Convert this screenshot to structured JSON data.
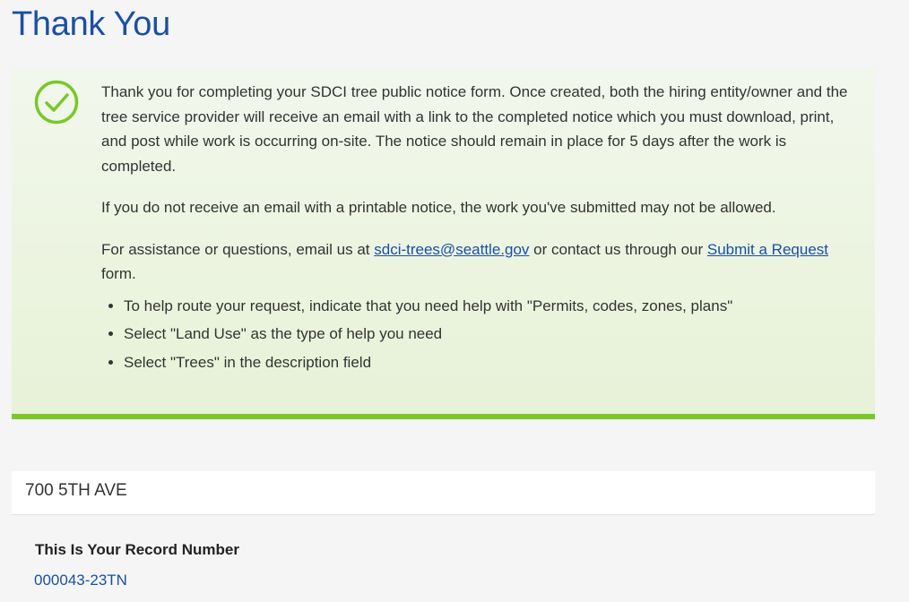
{
  "page": {
    "title": "Thank You"
  },
  "notice": {
    "icon": "check-circle-icon",
    "accent_color": "#7ac72a",
    "paragraph1": "Thank you for completing your SDCI tree public notice form. Once created, both the hiring entity/owner and the tree service provider will receive an email with a link to the completed notice which you must download, print, and post while work is occurring on-site. The notice should remain in place for 5 days after the work is completed.",
    "paragraph2": "If you do not receive an email with a printable notice, the work you've submitted may not be allowed.",
    "assistance": {
      "text_before": "For assistance or questions, email us at ",
      "email_link": "sdci-trees@seattle.gov",
      "text_middle": " or contact us through our ",
      "request_link": "Submit a Request",
      "text_after": " form."
    },
    "bullets": [
      "To help route your request, indicate that you need help with \"Permits, codes, zones, plans\"",
      "Select \"Land Use\" as the type of help you need",
      "Select \"Trees\" in the description field"
    ]
  },
  "address": "700 5TH AVE",
  "record": {
    "label": "This Is Your Record Number",
    "number": "000043-23TN"
  }
}
